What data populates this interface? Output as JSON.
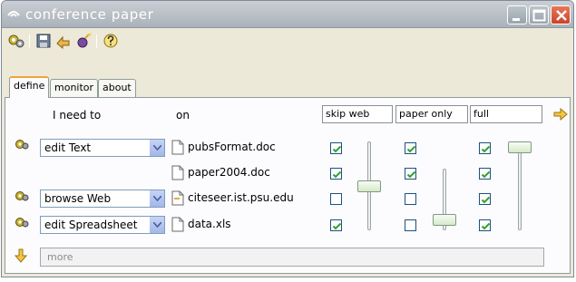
{
  "window": {
    "title": "conference paper"
  },
  "toolbar": {
    "buttons": [
      {
        "name": "tools-icon"
      },
      {
        "name": "save-icon"
      },
      {
        "name": "share-icon"
      },
      {
        "name": "wizard-icon"
      },
      {
        "name": "help-icon"
      }
    ]
  },
  "tabs": [
    {
      "label": "define",
      "active": true
    },
    {
      "label": "monitor",
      "active": false
    },
    {
      "label": "about",
      "active": false
    }
  ],
  "columns": {
    "action_header": "I need to",
    "object_header": "on",
    "level_headers": [
      "skip web",
      "paper only",
      "full"
    ]
  },
  "rows": [
    {
      "verb": "edit Text",
      "document": "pubsFormat.doc",
      "checks": [
        true,
        true,
        true
      ]
    },
    {
      "verb": "",
      "document": "paper2004.doc",
      "checks": [
        true,
        true,
        true
      ]
    },
    {
      "verb": "browse Web",
      "document": "citeseer.ist.psu.edu",
      "checks": [
        false,
        false,
        true
      ]
    },
    {
      "verb": "edit Spreadsheet",
      "document": "data.xls",
      "checks": [
        true,
        false,
        true
      ]
    }
  ],
  "sliders": [
    {
      "name": "skip-web-slider",
      "level": 0.5
    },
    {
      "name": "paper-only-slider",
      "level": 0.1
    },
    {
      "name": "full-slider",
      "level": 1.0
    }
  ],
  "more": {
    "placeholder": "more"
  },
  "colors": {
    "accent": "#f1a33b",
    "check": "#2fa12f",
    "title_text": "#ffffff"
  }
}
